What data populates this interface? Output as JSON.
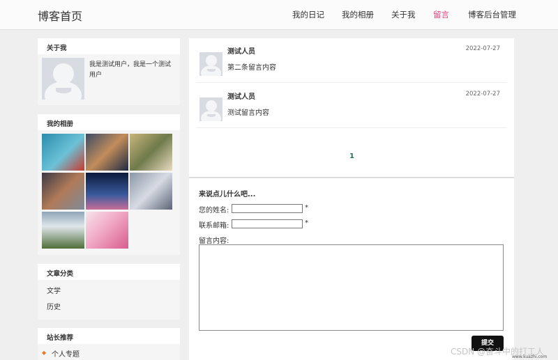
{
  "header": {
    "brand": "博客首页",
    "nav": [
      {
        "label": "我的日记"
      },
      {
        "label": "我的相册"
      },
      {
        "label": "关于我"
      },
      {
        "label": "留言",
        "active": true
      },
      {
        "label": "博客后台管理"
      }
    ]
  },
  "sidebar": {
    "about": {
      "title": "关于我",
      "desc": "我是测试用户，我是一个测试用户"
    },
    "album": {
      "title": "我的相册",
      "photos": [
        {
          "alt": "anime-swimmer",
          "colors": [
            "#2a8cab",
            "#6cc2d8",
            "#c73a2c"
          ]
        },
        {
          "alt": "anime-ocean-boat",
          "colors": [
            "#3b4b66",
            "#c28d5a",
            "#1d2a43"
          ]
        },
        {
          "alt": "anime-girl-room",
          "colors": [
            "#c9b57d",
            "#6f7a4b",
            "#e8dcc1"
          ]
        },
        {
          "alt": "anime-face-closeup",
          "colors": [
            "#3b3a45",
            "#b07a58",
            "#7d8a9a"
          ]
        },
        {
          "alt": "anime-night-window",
          "colors": [
            "#0c1a3b",
            "#3a5a9c",
            "#c86c98"
          ]
        },
        {
          "alt": "anime-girl-outdoor",
          "colors": [
            "#8b96a5",
            "#d8dbe4",
            "#5b6476"
          ]
        },
        {
          "alt": "anime-mountain-valley",
          "colors": [
            "#8fa6b8",
            "#4f6e3b",
            "#dfe6ea"
          ]
        },
        {
          "alt": "anime-helmet-pink",
          "colors": [
            "#f1a9c5",
            "#d85c8e",
            "#f6e3ea"
          ]
        }
      ]
    },
    "categories": {
      "title": "文章分类",
      "items": [
        "文学",
        "历史"
      ]
    },
    "recommend": {
      "title": "站长推荐",
      "items": [
        "个人专题"
      ]
    }
  },
  "messages": [
    {
      "name": "测试人员",
      "date": "2022-07-27",
      "content": "第二条留言内容"
    },
    {
      "name": "测试人员",
      "date": "2022-07-27",
      "content": "测试留言内容"
    }
  ],
  "pagination": {
    "current": "1"
  },
  "form": {
    "title": "来说点儿什么吧...",
    "name_label": "您的姓名:",
    "email_label": "联系邮箱:",
    "content_label": "留言内容:",
    "required_mark": "*",
    "name_value": "",
    "email_value": "",
    "submit_label": "提交"
  },
  "watermark": {
    "csdn": "CSDN @奋斗中的打工人",
    "site": "www.kuazhi.com"
  },
  "colors": {
    "accent": "#e2437f",
    "pager": "#266a57",
    "button": "#111111"
  }
}
